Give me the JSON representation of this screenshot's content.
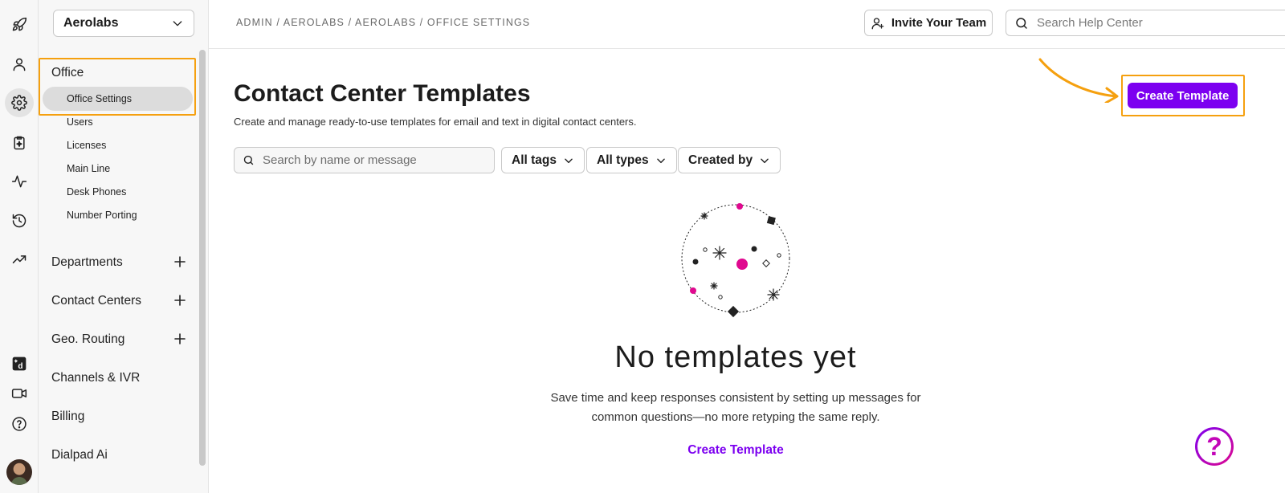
{
  "rail": {
    "icons": [
      "rocket-icon",
      "person-icon",
      "gear-icon",
      "clipboard-sparkle-icon",
      "activity-icon",
      "history-icon",
      "trending-up-icon",
      "dialpad-logo-icon",
      "video-icon",
      "help-circle-icon"
    ],
    "active_icon": "gear-icon"
  },
  "sidebar": {
    "org_name": "Aerolabs",
    "office_label": "Office",
    "office_items": [
      "Office Settings",
      "Users",
      "Licenses",
      "Main Line",
      "Desk Phones",
      "Number Porting"
    ],
    "selected_item": "Office Settings",
    "sections": [
      "Departments",
      "Contact Centers",
      "Geo. Routing",
      "Channels & IVR",
      "Billing",
      "Dialpad Ai"
    ]
  },
  "header": {
    "breadcrumb": "ADMIN / AEROLABS / AEROLABS / OFFICE SETTINGS",
    "invite_label": "Invite Your Team",
    "help_search_placeholder": "Search Help Center"
  },
  "main": {
    "title": "Contact Center Templates",
    "subtitle": "Create and manage ready-to-use templates for email and text in digital contact centers.",
    "create_button": "Create Template",
    "search_placeholder": "Search by name or message",
    "filters": [
      "All tags",
      "All types",
      "Created by"
    ],
    "empty_title": "No templates yet",
    "empty_desc": "Save time and keep responses consistent by setting up messages for common questions—no more retyping the same reply.",
    "empty_link": "Create Template"
  },
  "colors": {
    "accent": "#7c00f0",
    "highlight": "#f5a00f",
    "magenta": "#e0098f"
  },
  "help_fab": "?"
}
